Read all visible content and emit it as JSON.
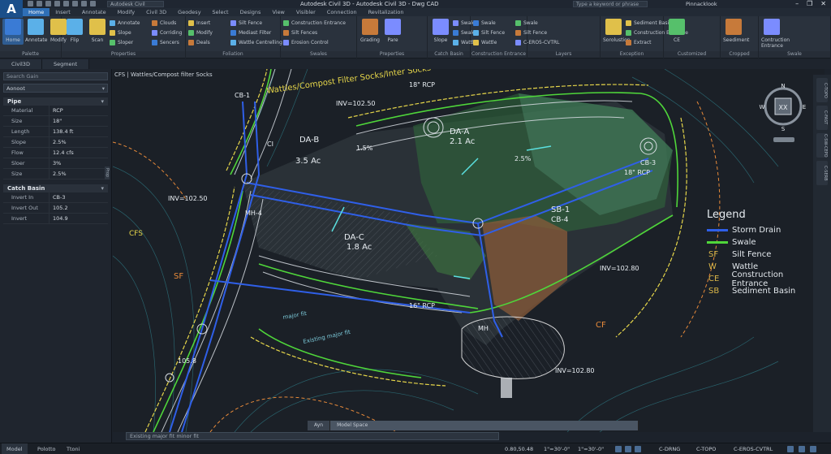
{
  "window": {
    "app_letter": "A",
    "quick_search": "Autodesk Civil",
    "title": "Autodesk Civil 3D - Autodesk Civil 3D - Dwg CAD",
    "help_search": "Type a keyword or phrase",
    "user": "Pinnacklook",
    "buttons": [
      "–",
      "❐",
      "✕"
    ]
  },
  "ribbon_tabs": [
    "Home",
    "Insert",
    "Annotate",
    "Modify",
    "Civil 3D",
    "Geodesy",
    "Select",
    "Designs",
    "View",
    "Visibler",
    "Connection",
    "Revitalization"
  ],
  "ribbon": {
    "panels": [
      {
        "title": "Palette",
        "big": [
          "Home",
          "Annotate",
          "Modify"
        ]
      },
      {
        "title": "Properties",
        "big": [
          "Flip",
          "Scan"
        ],
        "small": [
          "Annotate",
          "Slope",
          "Sloper",
          "Clouds",
          "Corriding",
          "Sencers"
        ]
      },
      {
        "title": "Foliation",
        "small": [
          "Insert",
          "Modify",
          "Deals",
          "Silt Fence",
          "Mediast Filter",
          "Wattle Centrelling"
        ]
      },
      {
        "title": "Swales",
        "small": [
          "Construction Entrance",
          "Silt Fences",
          "Erosion Control"
        ]
      },
      {
        "title": "Preperties",
        "big": [
          "Grading",
          "Pare"
        ]
      },
      {
        "title": "Catch Basin",
        "big": [
          "Slope"
        ],
        "small": [
          "Swale",
          "Swale",
          "Wattle"
        ]
      },
      {
        "title": "Construction Entrance",
        "small": [
          "Swale",
          "Silt Fence",
          "Wattle",
          "Swale",
          "Silt Fence",
          "C-ERO5-CVTRL"
        ]
      },
      {
        "title": "Layers",
        "small": []
      },
      {
        "title": "Exception",
        "big": [
          "Sorolustion"
        ],
        "small": [
          "Sediment Basin",
          "Construction Entrance",
          "Extract"
        ]
      },
      {
        "title": "Customized",
        "big": [
          "CE"
        ]
      },
      {
        "title": "Cropped",
        "big": [
          "Seediment"
        ]
      },
      {
        "title": "Swale",
        "big": [
          "Contruction Entrance"
        ]
      }
    ]
  },
  "doc_tabs": [
    "Civil3D",
    "Segment"
  ],
  "palette": {
    "search_placeholder": "Search Gain",
    "selected": "Aonoot",
    "pipe_section": "Pipe",
    "pipe": [
      {
        "k": "Material",
        "v": "RCP"
      },
      {
        "k": "Size",
        "v": "18\""
      },
      {
        "k": "Length",
        "v": "138.4 ft"
      },
      {
        "k": "Slope",
        "v": "2.5%"
      },
      {
        "k": "Flow",
        "v": "12.4 cfs"
      },
      {
        "k": "Sloer",
        "v": "3%"
      },
      {
        "k": "Size",
        "v": "2.5%"
      }
    ],
    "basin_section": "Catch Basin",
    "basin": [
      {
        "k": "Invert In",
        "v": "CB-3"
      },
      {
        "k": "Invert Out",
        "v": "105.2"
      },
      {
        "k": "Invert",
        "v": "104.9"
      }
    ],
    "side_tab": "Prop"
  },
  "drawing": {
    "viewport_label": "CFS | Wattles/Compost filter Socks",
    "labels": [
      {
        "t": "Wattles/Compost Filter Socks/Inter Socks",
        "c": "#e6d64a",
        "s": 10
      },
      {
        "t": "18\" RCP",
        "c": "#e8edf2",
        "s": 8
      },
      {
        "t": "INV=102.50",
        "c": "#e8edf2",
        "s": 8
      },
      {
        "t": "DA-A",
        "c": "#e8edf2",
        "s": 10
      },
      {
        "t": "2.1 Ac",
        "c": "#e8edf2",
        "s": 10
      },
      {
        "t": "DA-B",
        "c": "#e8edf2",
        "s": 10
      },
      {
        "t": "3.5 Ac",
        "c": "#e8edf2",
        "s": 10
      },
      {
        "t": "DA-C",
        "c": "#e8edf2",
        "s": 10
      },
      {
        "t": "1.8 Ac",
        "c": "#e8edf2",
        "s": 10
      },
      {
        "t": "SB-1",
        "c": "#e8edf2",
        "s": 10
      },
      {
        "t": "CB-4",
        "c": "#e8edf2",
        "s": 9
      },
      {
        "t": "MH",
        "c": "#e8edf2",
        "s": 8
      },
      {
        "t": "MH-4",
        "c": "#e8edf2",
        "s": 8
      },
      {
        "t": "CB-1",
        "c": "#e8edf2",
        "s": 8
      },
      {
        "t": "CB-3",
        "c": "#e8edf2",
        "s": 8
      },
      {
        "t": "SF",
        "c": "#e88a3a",
        "s": 10
      },
      {
        "t": "CF",
        "c": "#e88a3a",
        "s": 10
      },
      {
        "t": "CFS",
        "c": "#e6d64a",
        "s": 9
      },
      {
        "t": "CI",
        "c": "#e8edf2",
        "s": 8
      },
      {
        "t": "2.5%",
        "c": "#e8edf2",
        "s": 8
      },
      {
        "t": "1.5%",
        "c": "#e8edf2",
        "s": 8
      },
      {
        "t": "105.8",
        "c": "#e8edf2",
        "s": 8
      },
      {
        "t": "major fit",
        "c": "#7bc8d8",
        "s": 7
      },
      {
        "t": "Existing major fit",
        "c": "#7bc8d8",
        "s": 7
      },
      {
        "t": "18\" RCP",
        "c": "#e8edf2",
        "s": 8
      },
      {
        "t": "INV=102.50",
        "c": "#e8edf2",
        "s": 8
      },
      {
        "t": "INV=102.80",
        "c": "#e8edf2",
        "s": 8
      },
      {
        "t": "INV=102.80",
        "c": "#e8edf2",
        "s": 8
      },
      {
        "t": "16\" RCP",
        "c": "#e8edf2",
        "s": 8
      }
    ],
    "legend": {
      "title": "Legend",
      "items": [
        {
          "sym": "line",
          "color": "#2f5fe8",
          "label": "Storm Drain"
        },
        {
          "sym": "line",
          "color": "#4fd63a",
          "label": "Swale"
        },
        {
          "sym": "SF",
          "color": "#d9b548",
          "label": "Silt Fence"
        },
        {
          "sym": "W",
          "color": "#d9b548",
          "label": "Wattle"
        },
        {
          "sym": "CE",
          "color": "#d9b548",
          "label": "Construction Entrance"
        },
        {
          "sym": "SB",
          "color": "#d9b548",
          "label": "Sediment Basin"
        }
      ]
    },
    "viewcube": {
      "n": "N",
      "s": "S",
      "e": "E",
      "w": "W",
      "center": "XX"
    },
    "layout_tabs": [
      "Ayn",
      "Model Space"
    ],
    "nav_right": [
      "C-TOPO",
      "C-FAST",
      "C-SW-CEPO",
      "C-SERB"
    ]
  },
  "command_line": "Existing major fit minor fit",
  "status": {
    "tabs": [
      "Model",
      "Polotto",
      "Ttoni"
    ],
    "coords": "0.80,50.48",
    "scale1": "1\"=30'-0\"",
    "scale2": "1\"=30'-0\"",
    "layers": [
      "C-DRNG",
      "C-TOPO",
      "C-EROS-CVTRL"
    ]
  }
}
